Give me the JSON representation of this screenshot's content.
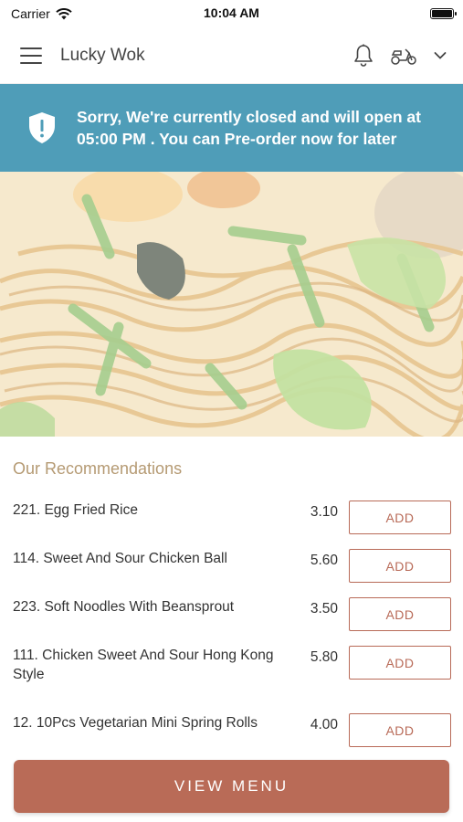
{
  "status_bar": {
    "carrier": "Carrier",
    "time": "10:04 AM"
  },
  "header": {
    "title": "Lucky Wok"
  },
  "banner": {
    "message": "Sorry, We're currently closed and will open at 05:00 PM . You can Pre-order now for later",
    "color": "#4f9db8"
  },
  "section": {
    "title": "Our Recommendations"
  },
  "menu_items": [
    {
      "name": "221. Egg Fried Rice",
      "price": "3.10",
      "action": "ADD"
    },
    {
      "name": "114. Sweet And Sour Chicken Ball",
      "price": "5.60",
      "action": "ADD"
    },
    {
      "name": "223. Soft Noodles With Beansprout",
      "price": "3.50",
      "action": "ADD"
    },
    {
      "name": "111. Chicken Sweet And Sour Hong Kong Style",
      "price": "5.80",
      "action": "ADD"
    },
    {
      "name": "12. 10Pcs Vegetarian Mini Spring Rolls",
      "price": "4.00",
      "action": "ADD"
    }
  ],
  "footer": {
    "view_menu_label": "VIEW MENU"
  },
  "colors": {
    "accent": "#b96b57",
    "banner": "#4f9db8",
    "section_title": "#b59a73"
  },
  "icons": {
    "menu": "hamburger-icon",
    "notifications": "bell-icon",
    "delivery": "scooter-icon",
    "dropdown": "chevron-down-icon",
    "banner": "shield-exclamation-icon"
  }
}
